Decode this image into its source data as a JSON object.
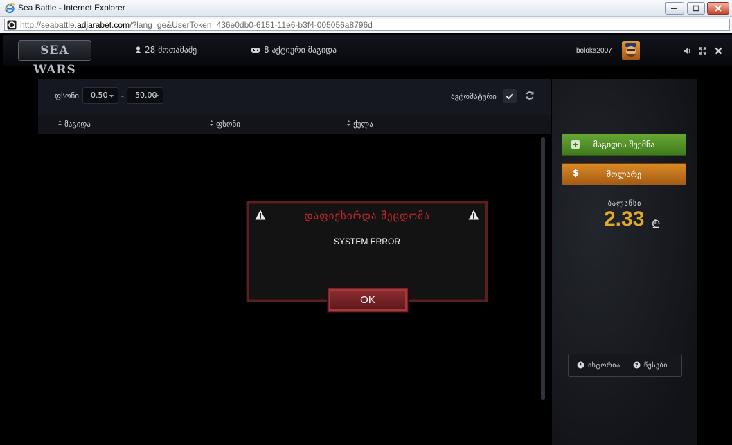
{
  "browser": {
    "window_title": "Sea Battle - Internet Explorer",
    "url_prefix": "http://seabattle.",
    "url_domain": "adjarabet.com",
    "url_rest": "/?lang=ge&UserToken=436e0db0-6151-11e6-b3f4-005056a8796d"
  },
  "header": {
    "logo": "SEA WARS",
    "players": "28 მოთამაშე",
    "active_games": "8 აქტიური მაგიდა",
    "username": "bolokа2007"
  },
  "lobby": {
    "bet_label": "ფსონი",
    "min_bet": "0.50",
    "dash": "-",
    "max_bet": "50.00",
    "auto_label": "ავტომატური",
    "columns": [
      "მაგიდა",
      "ფსონი",
      "ქულა"
    ]
  },
  "sidebar": {
    "create_table": "მაგიდის შექმნა",
    "deposit": "მოლარე",
    "balance_label": "ბალანსი",
    "balance_value": "2.33",
    "currency_sign": "₾",
    "history": "ისტორია",
    "rules": "წესები"
  },
  "modal": {
    "title": "დაფიქსირდა შეცდომა",
    "message": "SYSTEM ERROR",
    "ok": "OK"
  },
  "colors": {
    "accent_green": "#67a733",
    "accent_orange": "#d98a25",
    "balance_gold": "#e0ab2a",
    "error_red": "#c2272a"
  }
}
